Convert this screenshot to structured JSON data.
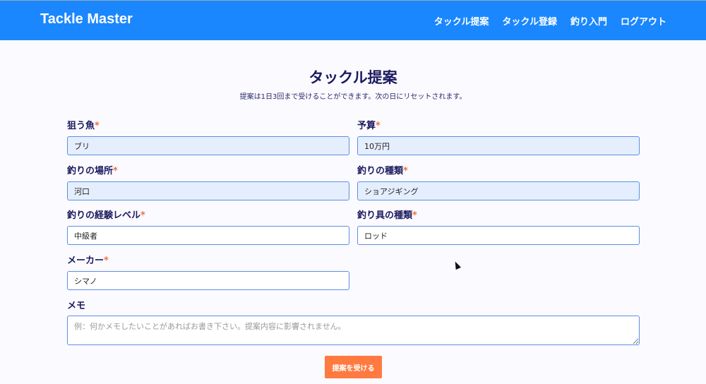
{
  "header": {
    "brand": "Tackle Master",
    "nav": [
      "タックル提案",
      "タックル登録",
      "釣り入門",
      "ログアウト"
    ]
  },
  "page": {
    "title": "タックル提案",
    "subtitle": "提案は1日3回まで受けることができます。次の日にリセットされます。"
  },
  "fields": [
    {
      "label": "狙う魚",
      "value": "ブリ"
    },
    {
      "label": "予算",
      "value": "10万円"
    },
    {
      "label": "釣りの場所",
      "value": "河口"
    },
    {
      "label": "釣りの種類",
      "value": "ショアジギング"
    },
    {
      "label": "釣りの経験レベル",
      "value": "中級者"
    },
    {
      "label": "釣り具の種類",
      "value": "ロッド"
    },
    {
      "label": "メーカー",
      "value": "シマノ"
    }
  ],
  "required_mark": "*",
  "memo": {
    "label": "メモ",
    "placeholder": "例：何かメモしたいことがあればお書き下さい。提案内容に影響されません。"
  },
  "submit_label": "提案を受ける"
}
